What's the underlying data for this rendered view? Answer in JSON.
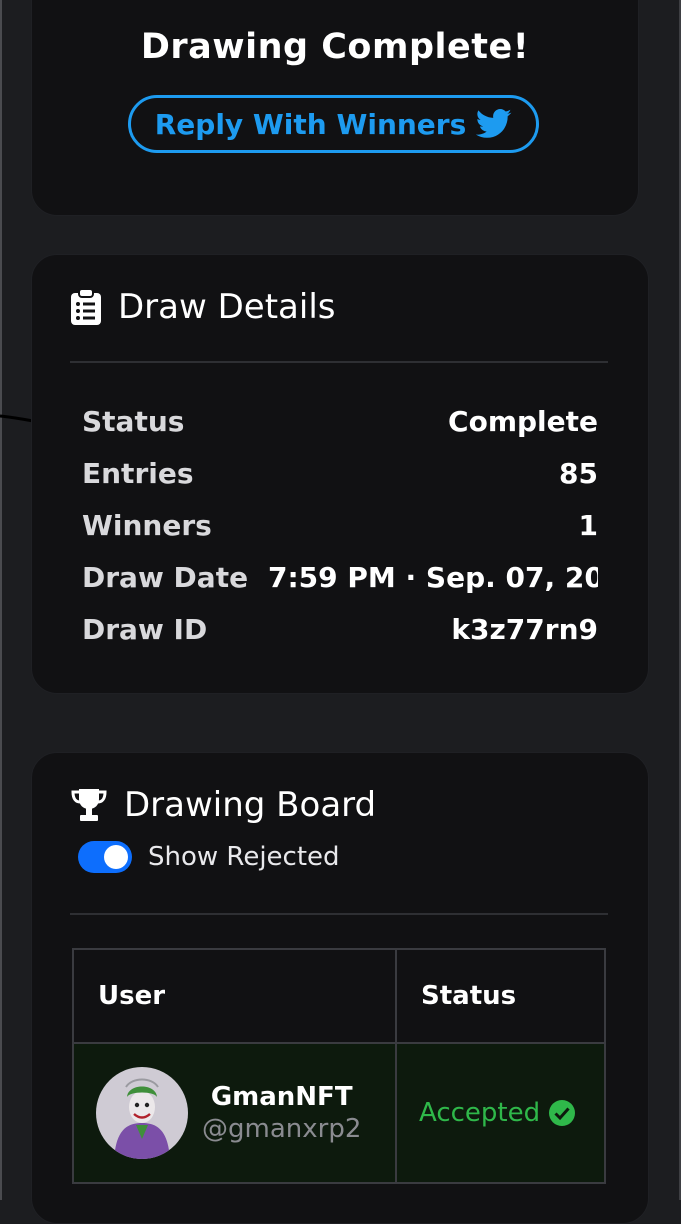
{
  "header": {
    "title": "Drawing Complete!",
    "reply_button": "Reply With Winners",
    "accent": "#1d9bf0"
  },
  "details": {
    "title": "Draw Details",
    "icon": "clipboard-list-icon",
    "rows": [
      {
        "key": "Status",
        "value": "Complete"
      },
      {
        "key": "Entries",
        "value": "85"
      },
      {
        "key": "Winners",
        "value": "1"
      },
      {
        "key": "Draw Date",
        "value": "7:59 PM · Sep. 07, 20"
      },
      {
        "key": "Draw ID",
        "value": "k3z77rn9"
      }
    ]
  },
  "board": {
    "title": "Drawing Board",
    "icon": "trophy-icon",
    "toggle_label": "Show Rejected",
    "toggle_on": true,
    "columns": [
      "User",
      "Status"
    ],
    "rows": [
      {
        "name": "GmanNFT",
        "handle": "@gmanxrp2",
        "status": "Accepted",
        "status_color": "#2fb84a"
      }
    ]
  }
}
